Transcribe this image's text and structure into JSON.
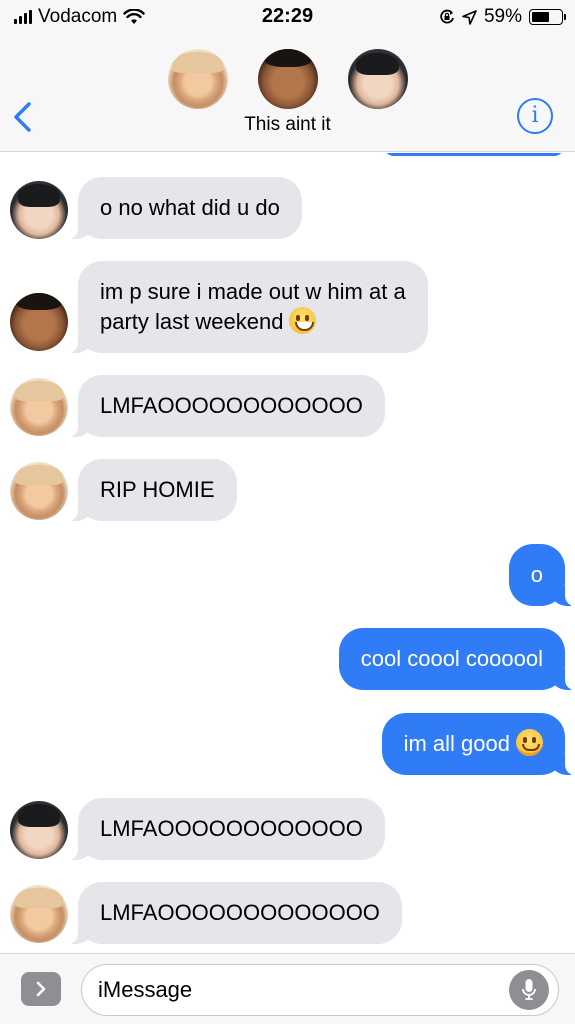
{
  "status_bar": {
    "carrier": "Vodacom",
    "time": "22:29",
    "battery": "59%",
    "battery_level": 0.59,
    "icons": [
      "signal-icon",
      "wifi-icon",
      "orientation-lock-icon",
      "location-icon",
      "battery-icon"
    ]
  },
  "header": {
    "title": "This aint it",
    "info_label": "i",
    "participants": [
      "participant-a",
      "participant-b",
      "participant-c"
    ]
  },
  "messages": [
    {
      "text": "o no what did u do",
      "direction": "incoming",
      "sender": "participant-c"
    },
    {
      "text": "im p sure i made out w him at a",
      "text2": "party last weekend",
      "emoji": "grinning-face",
      "direction": "incoming",
      "sender": "participant-b"
    },
    {
      "text": "LMFAOOOOOOOOOOOO",
      "direction": "incoming",
      "sender": "participant-a"
    },
    {
      "text": "RIP HOMIE",
      "direction": "incoming",
      "sender": "participant-a"
    },
    {
      "text": "o",
      "direction": "outgoing"
    },
    {
      "text": "cool coool coooool",
      "direction": "outgoing"
    },
    {
      "text": "im all good",
      "emoji": "hugging-face",
      "direction": "outgoing"
    },
    {
      "text": "LMFAOOOOOOOOOOOO",
      "direction": "incoming",
      "sender": "participant-c"
    },
    {
      "text": "LMFAOOOOOOOOOOOOO",
      "direction": "incoming",
      "sender": "participant-a"
    }
  ],
  "input": {
    "placeholder": "iMessage"
  },
  "colors": {
    "accent": "#2f7cf6",
    "incoming_bubble": "#e5e5ea",
    "header_bg": "#f7f7f7"
  }
}
